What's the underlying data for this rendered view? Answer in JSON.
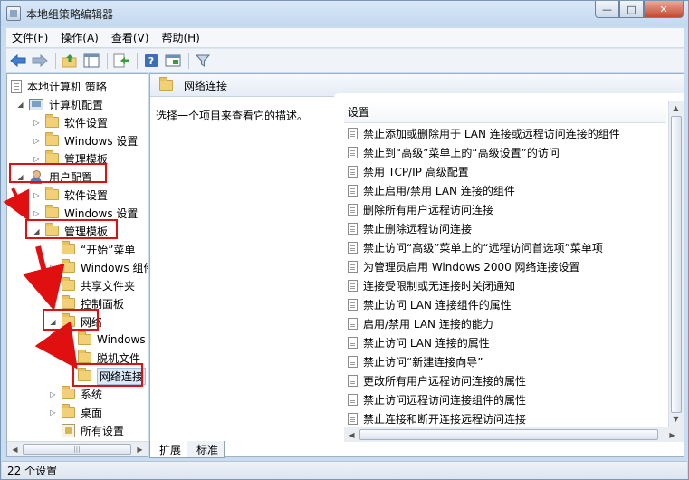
{
  "window": {
    "title": "本地组策略编辑器",
    "min": "—",
    "max": "□",
    "close": "✕"
  },
  "menubar": [
    "文件(F)",
    "操作(A)",
    "查看(V)",
    "帮助(H)"
  ],
  "toolbar": {
    "icons": [
      "back-icon",
      "forward-icon",
      "up-folder-icon",
      "show-hide-tree-icon",
      "export-list-icon",
      "help-icon",
      "properties-icon",
      "filter-icon"
    ]
  },
  "tree": {
    "root": "本地计算机 策略",
    "items": [
      {
        "label": "计算机配置",
        "exp": "◢",
        "icon": "computer-icon"
      },
      {
        "label": "软件设置",
        "exp": "▷",
        "icon": "folder-icon"
      },
      {
        "label": "Windows 设置",
        "exp": "▷",
        "icon": "folder-icon"
      },
      {
        "label": "管理模板",
        "exp": "▷",
        "icon": "folder-icon"
      },
      {
        "label": "用户配置",
        "exp": "◢",
        "icon": "user-icon"
      },
      {
        "label": "软件设置",
        "exp": "▷",
        "icon": "folder-icon"
      },
      {
        "label": "Windows 设置",
        "exp": "▷",
        "icon": "folder-icon"
      },
      {
        "label": "管理模板",
        "exp": "◢",
        "icon": "folder-icon"
      },
      {
        "label": "“开始”菜单",
        "exp": "",
        "icon": "folder-icon"
      },
      {
        "label": "Windows 组件",
        "exp": "▷",
        "icon": "folder-icon"
      },
      {
        "label": "共享文件夹",
        "exp": "",
        "icon": "folder-icon"
      },
      {
        "label": "控制面板",
        "exp": "▷",
        "icon": "folder-icon"
      },
      {
        "label": "网络",
        "exp": "◢",
        "icon": "folder-icon"
      },
      {
        "label": "Windows",
        "exp": "",
        "icon": "folder-icon"
      },
      {
        "label": "脱机文件",
        "exp": "",
        "icon": "folder-icon"
      },
      {
        "label": "网络连接",
        "exp": "",
        "icon": "folder-icon",
        "selected": true
      },
      {
        "label": "系统",
        "exp": "▷",
        "icon": "folder-icon"
      },
      {
        "label": "桌面",
        "exp": "▷",
        "icon": "folder-icon"
      },
      {
        "label": "所有设置",
        "exp": "",
        "icon": "settings-icon"
      }
    ],
    "scroll_left": "◀",
    "scroll_right": "▶",
    "thumb_grip": "|||"
  },
  "main": {
    "header_title": "网络连接",
    "description": "选择一个项目来查看它的描述。",
    "column_header": "设置",
    "items": [
      "禁止添加或删除用于 LAN 连接或远程访问连接的组件",
      "禁止到“高级”菜单上的“高级设置”的访问",
      "禁用 TCP/IP 高级配置",
      "禁止启用/禁用 LAN 连接的组件",
      "删除所有用户远程访问连接",
      "禁止删除远程访问连接",
      "禁止访问“高级”菜单上的“远程访问首选项”菜单项",
      "为管理员启用 Windows 2000 网络连接设置",
      "连接受限制或无连接时关闭通知",
      "禁止访问 LAN 连接组件的属性",
      "启用/禁用 LAN 连接的能力",
      "禁止访问 LAN 连接的属性",
      "禁止访问“新建连接向导”",
      "更改所有用户远程访问连接的属性",
      "禁止访问远程访问连接组件的属性",
      "禁止连接和断开连接远程访问连接"
    ],
    "scroll_up": "▲",
    "scroll_down": "▼",
    "scroll_left": "◀",
    "scroll_right": "▶"
  },
  "tabs": [
    "扩展",
    "标准"
  ],
  "status": "22 个设置",
  "colors": {
    "highlight": "#e01010",
    "selection": "#dce9f9"
  }
}
